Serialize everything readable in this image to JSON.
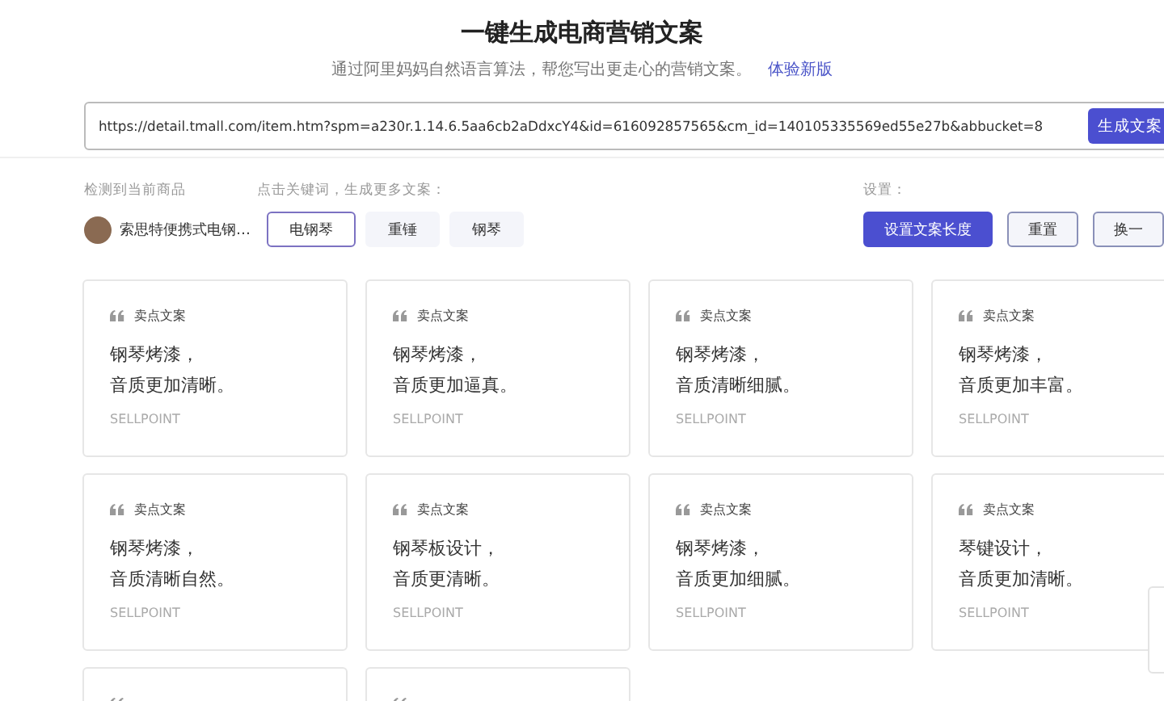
{
  "header": {
    "title": "一键生成电商营销文案",
    "subtitle": "通过阿里妈妈自然语言算法，帮您写出更走心的营销文案。",
    "link": "体验新版"
  },
  "url_bar": {
    "value": "https://detail.tmall.com/item.htm?spm=a230r.1.14.6.5aa6cb2aDdxcY4&id=616092857565&cm_id=140105335569ed55e27b&abbucket=8",
    "button": "生成文案"
  },
  "product": {
    "label": "检测到当前商品",
    "name": "索思特便携式电钢…"
  },
  "keywords": {
    "label": "点击关键词，生成更多文案：",
    "items": [
      {
        "label": "电钢琴",
        "selected": true
      },
      {
        "label": "重锤",
        "selected": false
      },
      {
        "label": "钢琴",
        "selected": false
      }
    ]
  },
  "settings": {
    "label": "设置：",
    "buttons": [
      {
        "label": "设置文案长度",
        "kind": "primary"
      },
      {
        "label": "重置",
        "kind": "secondary"
      },
      {
        "label": "换一",
        "kind": "secondary"
      }
    ]
  },
  "cards": [
    {
      "kind": "full",
      "tag": "卖点文案",
      "lines": [
        "钢琴烤漆，",
        "音质更加清晰。"
      ],
      "footer": "SELLPOINT"
    },
    {
      "kind": "full",
      "tag": "卖点文案",
      "lines": [
        "钢琴烤漆，",
        "音质更加逼真。"
      ],
      "footer": "SELLPOINT"
    },
    {
      "kind": "full",
      "tag": "卖点文案",
      "lines": [
        "钢琴烤漆，",
        "音质清晰细腻。"
      ],
      "footer": "SELLPOINT"
    },
    {
      "kind": "full",
      "tag": "卖点文案",
      "lines": [
        "钢琴烤漆，",
        "音质更加丰富。"
      ],
      "footer": "SELLPOINT"
    },
    {
      "kind": "full",
      "tag": "卖点文案",
      "lines": [
        "钢琴烤漆，",
        "音质清晰自然。"
      ],
      "footer": "SELLPOINT"
    },
    {
      "kind": "full",
      "tag": "卖点文案",
      "lines": [
        "钢琴板设计，",
        "音质更清晰。"
      ],
      "footer": "SELLPOINT"
    },
    {
      "kind": "full",
      "tag": "卖点文案",
      "lines": [
        "钢琴烤漆，",
        "音质更加细腻。"
      ],
      "footer": "SELLPOINT"
    },
    {
      "kind": "full",
      "tag": "卖点文案",
      "lines": [
        "琴键设计，",
        "音质更加清晰。"
      ],
      "footer": "SELLPOINT"
    },
    {
      "kind": "partial"
    },
    {
      "kind": "partial"
    }
  ]
}
